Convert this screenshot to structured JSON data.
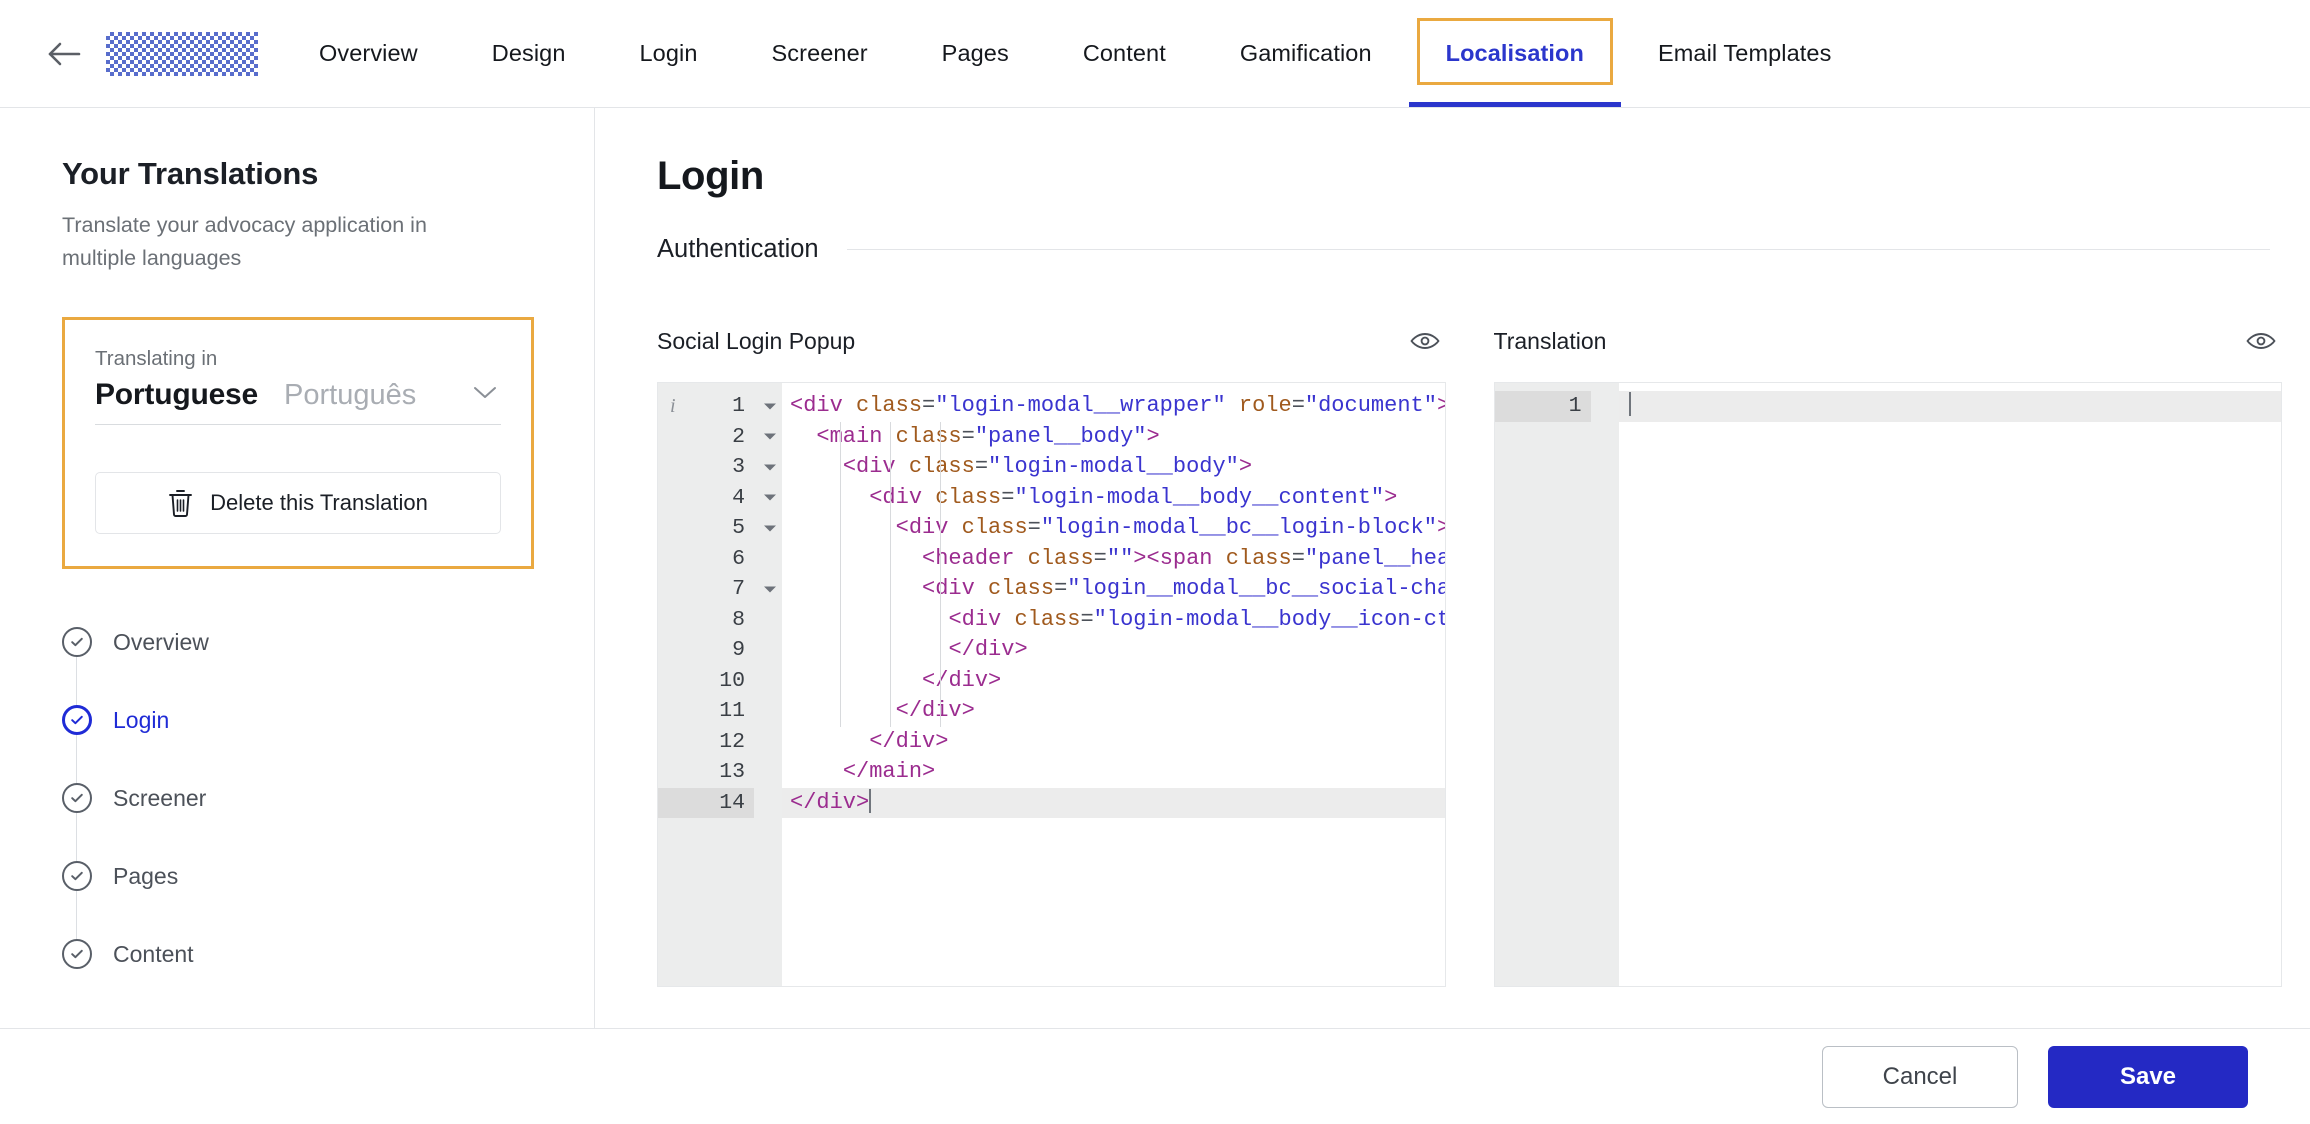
{
  "header": {
    "back_icon": "arrow-left-icon",
    "logo": "redacted-logo",
    "tabs": [
      {
        "label": "Overview",
        "active": false
      },
      {
        "label": "Design",
        "active": false
      },
      {
        "label": "Login",
        "active": false
      },
      {
        "label": "Screener",
        "active": false
      },
      {
        "label": "Pages",
        "active": false
      },
      {
        "label": "Content",
        "active": false
      },
      {
        "label": "Gamification",
        "active": false
      },
      {
        "label": "Localisation",
        "active": true
      },
      {
        "label": "Email Templates",
        "active": false
      }
    ],
    "active_tab_color": "#2b36cc",
    "focus_ring_color": "#eaa940"
  },
  "sidebar": {
    "title": "Your Translations",
    "subtitle": "Translate your advocacy application in multiple languages",
    "language_card": {
      "label": "Translating in",
      "language_name": "Portuguese",
      "language_native": "Português",
      "chevron_icon": "chevron-down-icon",
      "delete_label": "Delete this Translation",
      "delete_icon": "trash-icon",
      "border_color": "#eaa940"
    },
    "steps": [
      {
        "label": "Overview",
        "active": false,
        "icon": "check-circle-icon"
      },
      {
        "label": "Login",
        "active": true,
        "icon": "check-circle-icon"
      },
      {
        "label": "Screener",
        "active": false,
        "icon": "check-circle-icon"
      },
      {
        "label": "Pages",
        "active": false,
        "icon": "check-circle-icon"
      },
      {
        "label": "Content",
        "active": false,
        "icon": "check-circle-icon"
      }
    ]
  },
  "main": {
    "title": "Login",
    "section_title": "Authentication",
    "source_editor": {
      "label": "Social Login Popup",
      "eye_icon": "eye-icon",
      "active_line": 14,
      "info_marker": "i",
      "lines": [
        {
          "n": 1,
          "fold": true,
          "text": "<div class=\"login-modal__wrapper\" role=\"document\">"
        },
        {
          "n": 2,
          "fold": true,
          "text": "  <main class=\"panel__body\">"
        },
        {
          "n": 3,
          "fold": true,
          "text": "    <div class=\"login-modal__body\">"
        },
        {
          "n": 4,
          "fold": true,
          "text": "      <div class=\"login-modal__body__content\">"
        },
        {
          "n": 5,
          "fold": true,
          "text": "        <div class=\"login-modal__bc__login-block\">"
        },
        {
          "n": 6,
          "fold": false,
          "text": "          <header class=\"\"><span class=\"panel__hea"
        },
        {
          "n": 7,
          "fold": true,
          "text": "          <div class=\"login__modal__bc__social-cha"
        },
        {
          "n": 8,
          "fold": false,
          "text": "            <div class=\"login-modal__body__icon-ct"
        },
        {
          "n": 9,
          "fold": false,
          "text": "            </div>"
        },
        {
          "n": 10,
          "fold": false,
          "text": "          </div>"
        },
        {
          "n": 11,
          "fold": false,
          "text": "        </div>"
        },
        {
          "n": 12,
          "fold": false,
          "text": "      </div>"
        },
        {
          "n": 13,
          "fold": false,
          "text": "    </main>"
        },
        {
          "n": 14,
          "fold": false,
          "text": "</div>"
        }
      ]
    },
    "translation_editor": {
      "label": "Translation",
      "eye_icon": "eye-icon",
      "lines": [
        {
          "n": 1,
          "text": ""
        }
      ]
    }
  },
  "footer": {
    "cancel_label": "Cancel",
    "save_label": "Save",
    "save_color": "#2429c4"
  }
}
